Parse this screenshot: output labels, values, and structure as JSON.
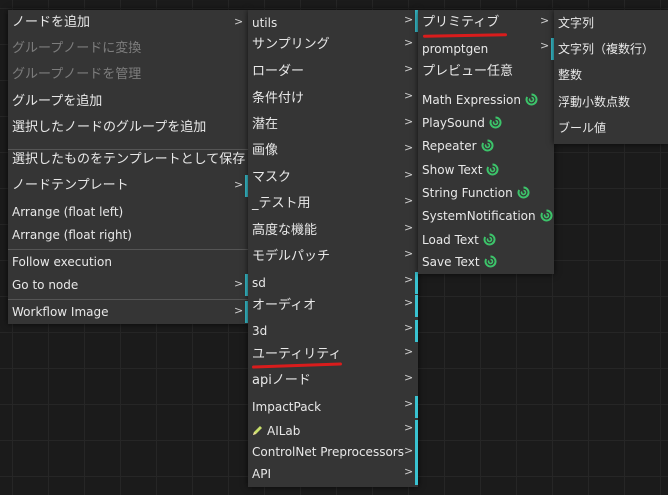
{
  "menu1": {
    "items": [
      "ノードを追加",
      "グループノードに変換",
      "グループノードを管理",
      "グループを追加",
      "選択したノードのグループを追加",
      "選択したものをテンプレートとして保存",
      "ノードテンプレート",
      "Arrange (float left)",
      "Arrange (float right)",
      "Follow execution",
      "Go to node",
      "Workflow Image"
    ]
  },
  "menu2": {
    "items": [
      "utils",
      "サンプリング",
      "ローダー",
      "条件付け",
      "潜在",
      "画像",
      "マスク",
      "_テスト用",
      "高度な機能",
      "モデルパッチ",
      "sd",
      "オーディオ",
      "3d",
      "ユーティリティ",
      "apiノード",
      "ImpactPack",
      "AILab",
      "ControlNet Preprocessors",
      "API"
    ]
  },
  "menu3": {
    "items": [
      "プリミティブ",
      "promptgen",
      "プレビュー任意",
      "Math Expression",
      "PlaySound",
      "Repeater",
      "Show Text",
      "String Function",
      "SystemNotification",
      "Load Text",
      "Save Text"
    ]
  },
  "menu4": {
    "items": [
      "文字列",
      "文字列（複数行）",
      "整数",
      "浮動小数点数",
      "ブール値"
    ]
  },
  "colors": {
    "menu_bg": "#353535",
    "accent_bar": "#39c2d0",
    "underline": "#d91c1c",
    "loop_icon": "#3cc46a",
    "disabled_text": "#7d7d7d"
  },
  "icons": {
    "submenu": "chevron-right-icon",
    "custom_node": "green-loop-icon",
    "ailab": "pencil-icon"
  }
}
